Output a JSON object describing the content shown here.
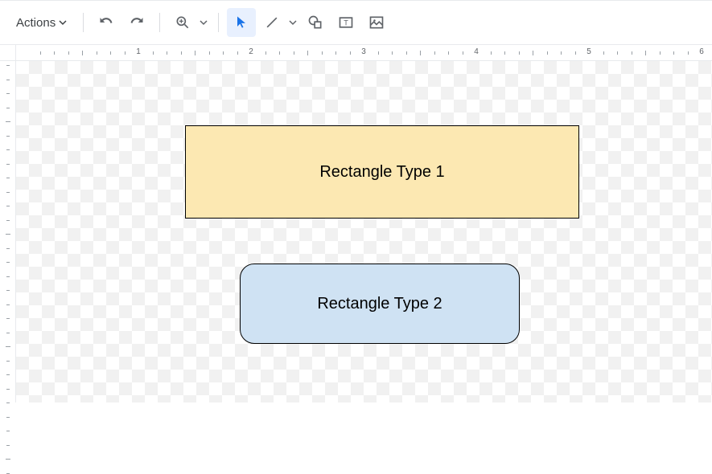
{
  "toolbar": {
    "actions_label": "Actions"
  },
  "ruler": {
    "marks": [
      "1",
      "2",
      "3",
      "4",
      "5",
      "6"
    ]
  },
  "shapes": {
    "rect1_label": "Rectangle Type 1",
    "rect2_label": "Rectangle Type 2"
  },
  "colors": {
    "rect1_fill": "#fce8b2",
    "rect2_fill": "#cfe2f3",
    "active_tool": "#1a73e8"
  }
}
